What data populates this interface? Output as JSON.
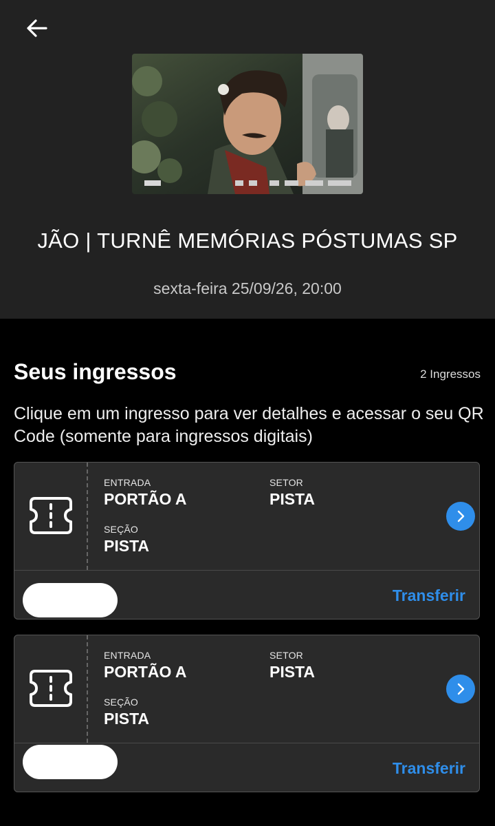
{
  "header": {
    "back_icon": "arrow-left-icon",
    "event_title": "JÃO | TURNÊ MEMÓRIAS PÓSTUMAS SP",
    "event_date": "sexta-feira 25/09/26, 20:00"
  },
  "tickets_section": {
    "title": "Seus ingressos",
    "count": "2 Ingressos",
    "instructions": "Clique em um ingresso para ver detalhes e acessar o seu QR Code (somente para ingressos digitais)"
  },
  "tickets": [
    {
      "entrada_label": "ENTRADA",
      "entrada_value": "PORTÃO A",
      "setor_label": "SETOR",
      "setor_value": "PISTA",
      "secao_label": "SEÇÃO",
      "secao_value": "PISTA",
      "transfer_label": "Transferir"
    },
    {
      "entrada_label": "ENTRADA",
      "entrada_value": "PORTÃO A",
      "setor_label": "SETOR",
      "setor_value": "PISTA",
      "secao_label": "SEÇÃO",
      "secao_value": "PISTA",
      "transfer_label": "Transferir"
    }
  ],
  "colors": {
    "header_bg": "#222222",
    "page_bg": "#000000",
    "card_bg": "#2a2a2a",
    "accent": "#2f8eea"
  }
}
